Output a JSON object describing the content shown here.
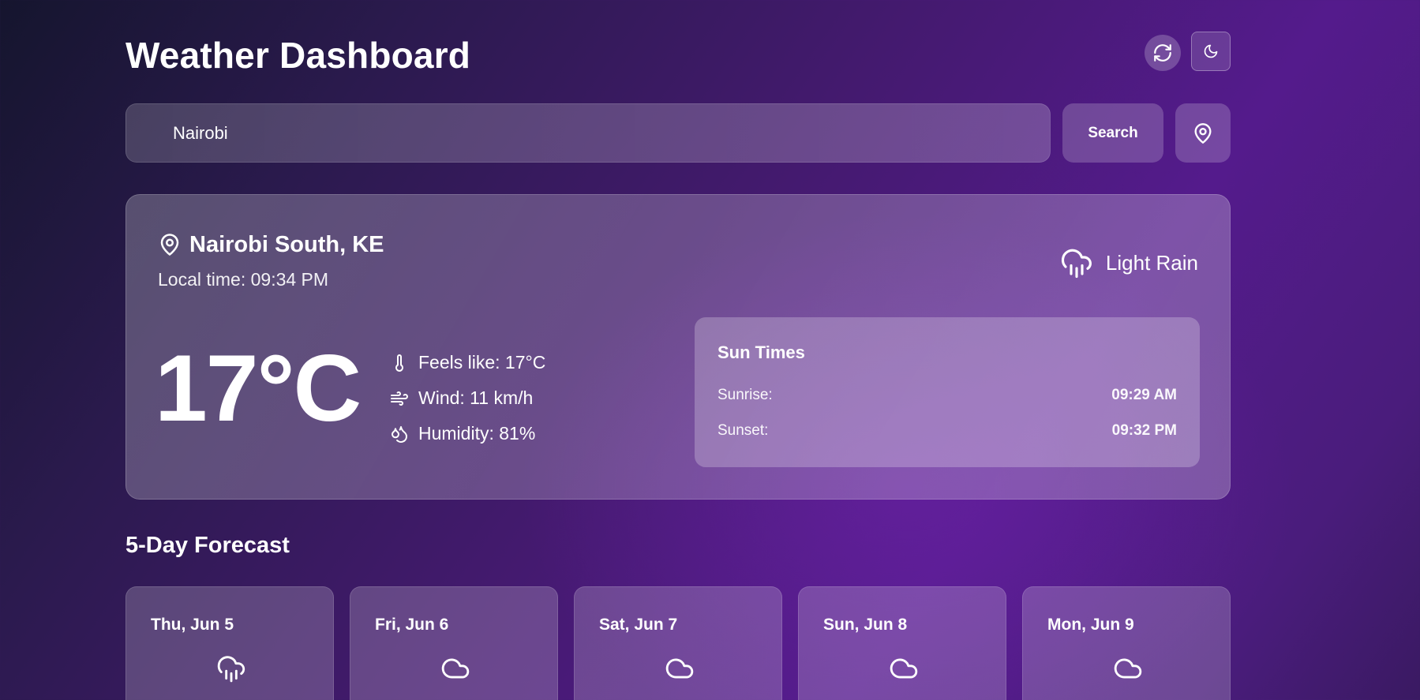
{
  "header": {
    "title": "Weather Dashboard",
    "refresh_icon": "refresh-icon",
    "theme_icon": "moon-icon"
  },
  "search": {
    "value": "Nairobi",
    "placeholder": "",
    "button_label": "Search",
    "location_icon": "map-pin-icon"
  },
  "current": {
    "location": "Nairobi South, KE",
    "local_time": "Local time: 09:34 PM",
    "condition": "Light Rain",
    "condition_icon": "cloud-rain-icon",
    "temperature": "17°C",
    "feels_like": "Feels like: 17°C",
    "wind": "Wind: 11 km/h",
    "humidity": "Humidity: 81%"
  },
  "sun_times": {
    "title": "Sun Times",
    "sunrise_label": "Sunrise:",
    "sunrise": "09:29 AM",
    "sunset_label": "Sunset:",
    "sunset": "09:32 PM"
  },
  "forecast": {
    "title": "5-Day Forecast",
    "days": [
      {
        "date": "Thu, Jun 5",
        "icon": "cloud-rain-icon"
      },
      {
        "date": "Fri, Jun 6",
        "icon": "cloud-icon"
      },
      {
        "date": "Sat, Jun 7",
        "icon": "cloud-icon"
      },
      {
        "date": "Sun, Jun 8",
        "icon": "cloud-icon"
      },
      {
        "date": "Mon, Jun 9",
        "icon": "cloud-icon"
      }
    ]
  },
  "colors": {
    "bg_dark": "#15152e",
    "bg_purple": "#541b8c",
    "text": "#ffffff"
  }
}
